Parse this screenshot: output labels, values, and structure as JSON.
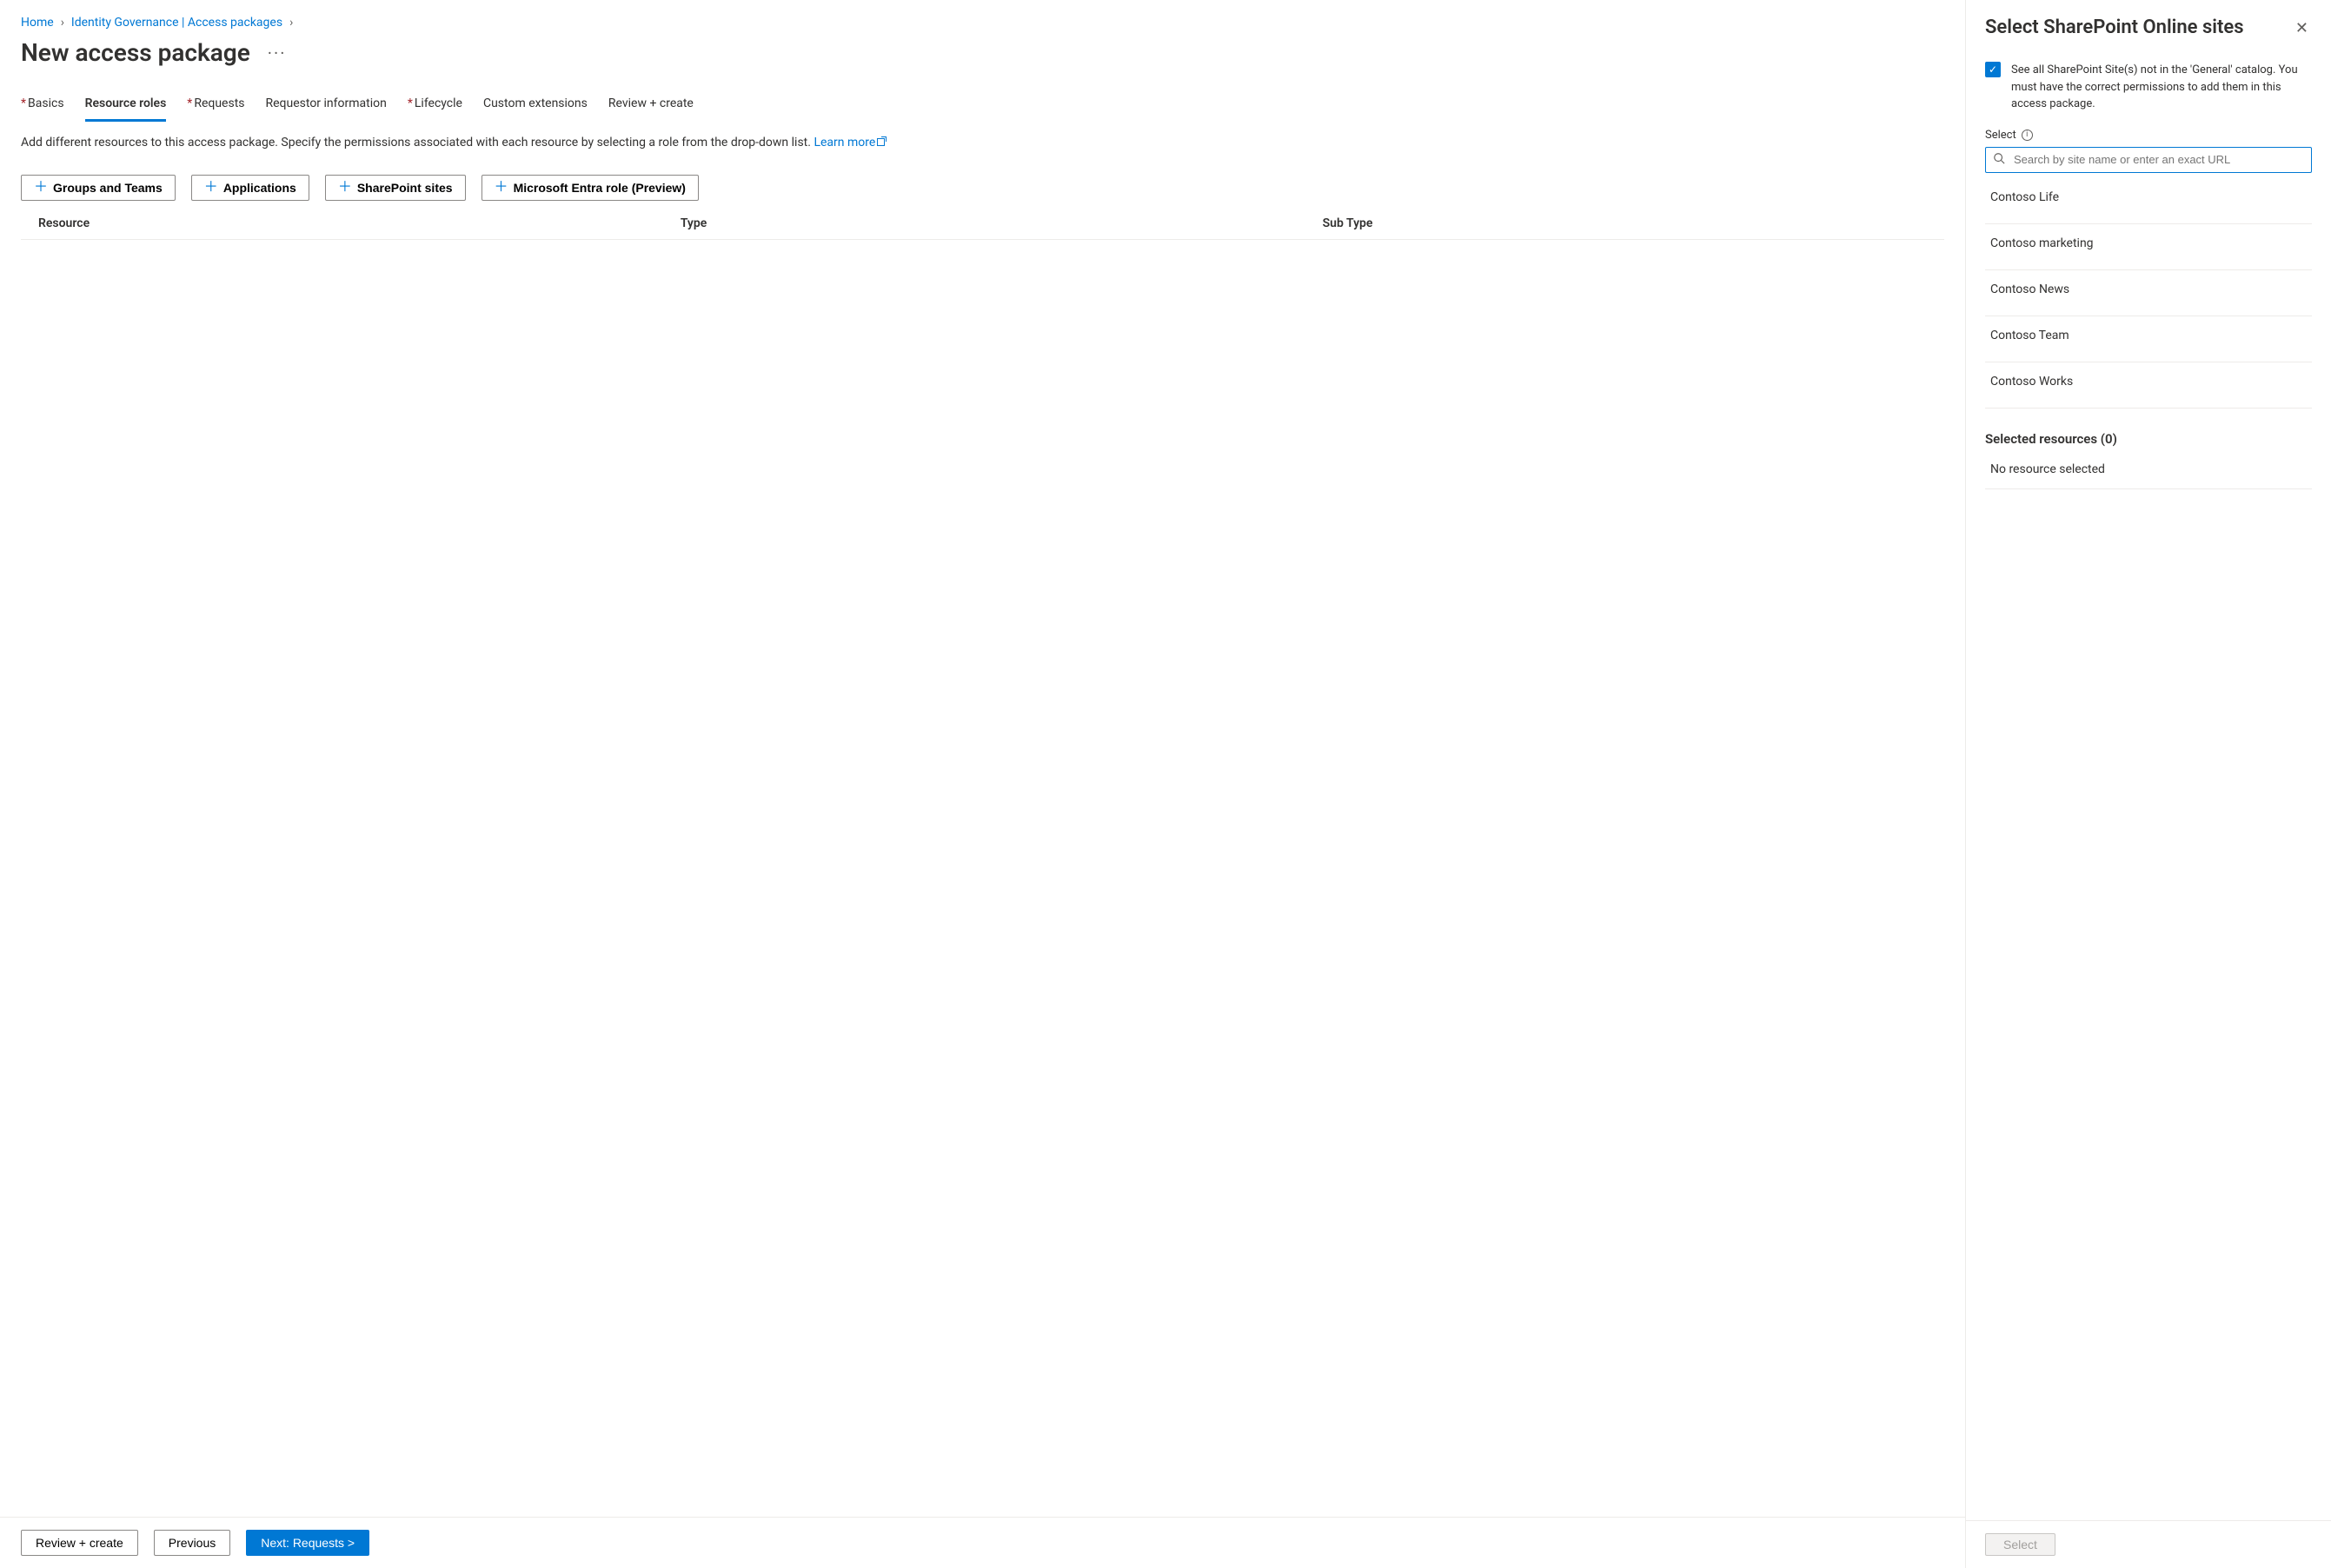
{
  "breadcrumb": {
    "home": "Home",
    "governance": "Identity Governance | Access packages"
  },
  "page_title": "New access package",
  "more_label": "···",
  "tabs": [
    {
      "label": "Basics",
      "required": true,
      "active": false
    },
    {
      "label": "Resource roles",
      "required": false,
      "active": true
    },
    {
      "label": "Requests",
      "required": true,
      "active": false
    },
    {
      "label": "Requestor information",
      "required": false,
      "active": false
    },
    {
      "label": "Lifecycle",
      "required": true,
      "active": false
    },
    {
      "label": "Custom extensions",
      "required": false,
      "active": false
    },
    {
      "label": "Review + create",
      "required": false,
      "active": false
    }
  ],
  "description": "Add different resources to this access package. Specify the permissions associated with each resource by selecting a role from the drop-down list.",
  "learn_more": "Learn more",
  "resource_buttons": {
    "groups": "Groups and Teams",
    "apps": "Applications",
    "sharepoint": "SharePoint sites",
    "entra": "Microsoft Entra role (Preview)"
  },
  "table_headers": {
    "resource": "Resource",
    "type": "Type",
    "subtype": "Sub Type"
  },
  "footer": {
    "review": "Review + create",
    "previous": "Previous",
    "next": "Next: Requests >"
  },
  "panel": {
    "title": "Select SharePoint Online sites",
    "checkbox_text": "See all SharePoint Site(s) not in the 'General' catalog. You must have the correct permissions to add them in this access package.",
    "select_label": "Select",
    "search_placeholder": "Search by site name or enter an exact URL",
    "sites": [
      "Contoso Life",
      "Contoso marketing",
      "Contoso News",
      "Contoso Team",
      "Contoso Works"
    ],
    "selected_header": "Selected resources (0)",
    "no_resource": "No resource selected",
    "select_button": "Select"
  }
}
